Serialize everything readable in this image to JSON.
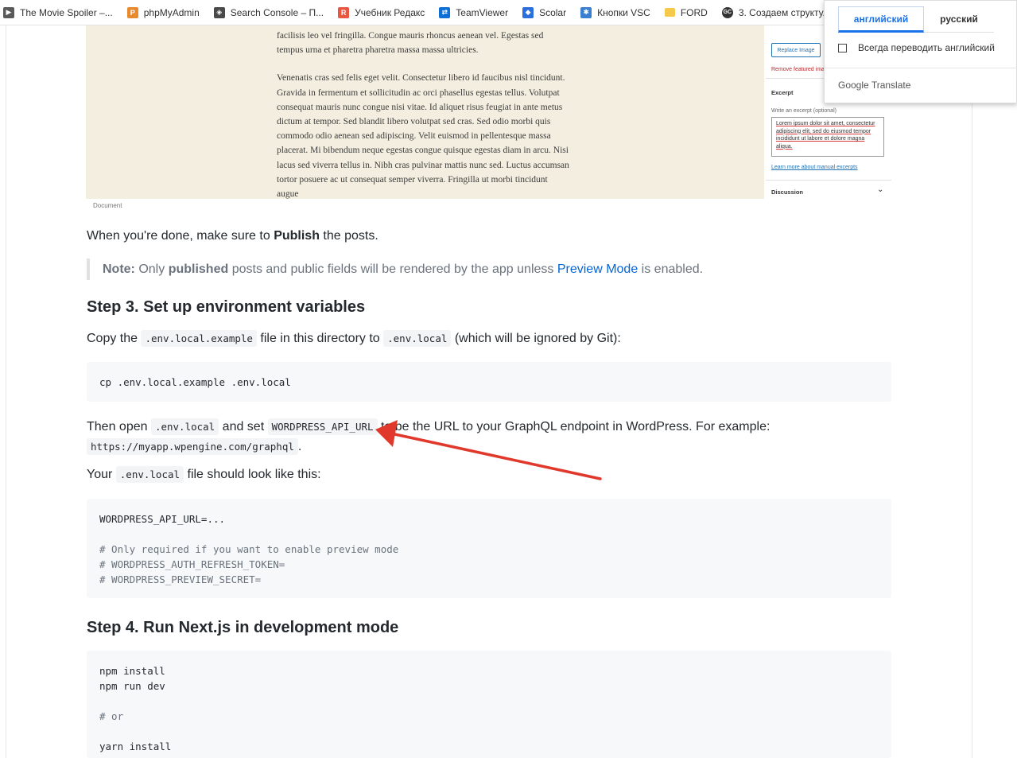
{
  "bookmarks": [
    {
      "label": "The Movie Spoiler –...",
      "icon": "movie-icon",
      "color": "#5a5a5a"
    },
    {
      "label": "phpMyAdmin",
      "icon": "phpmyadmin-icon",
      "color": "#e88a2e"
    },
    {
      "label": "Search Console – П...",
      "icon": "search-console-icon",
      "color": "#4a4a4a"
    },
    {
      "label": "Учебник Редакс",
      "icon": "redux-icon",
      "color": "#e8573f"
    },
    {
      "label": "TeamViewer",
      "icon": "teamviewer-icon",
      "color": "#0e6fd6"
    },
    {
      "label": "Scolar",
      "icon": "scolar-icon",
      "color": "#2a6fdb"
    },
    {
      "label": "Кнопки VSC",
      "icon": "vsc-icon",
      "color": "#3b7fd0"
    },
    {
      "label": "FORD",
      "icon": "folder-icon",
      "color": "#f6c94a"
    },
    {
      "label": "3. Создаем структу...",
      "icon": "gc-icon",
      "color": "#333333"
    }
  ],
  "screenshot": {
    "para1": "facilisis leo vel fringilla. Congue mauris rhoncus aenean vel. Egestas sed tempus urna et pharetra pharetra massa massa ultricies.",
    "para2": "Venenatis cras sed felis eget velit. Consectetur libero id faucibus nisl tincidunt. Gravida in fermentum et sollicitudin ac orci phasellus egestas tellus. Volutpat consequat mauris nunc congue nisi vitae. Id aliquet risus feugiat in ante metus dictum at tempor. Sed blandit libero volutpat sed cras. Sed odio morbi quis commodo odio aenean sed adipiscing. Velit euismod in pellentesque massa placerat. Mi bibendum neque egestas congue quisque egestas diam in arcu. Nisi lacus sed viverra tellus in. Nibh cras pulvinar mattis nunc sed. Luctus accumsan tortor posuere ac ut consequat semper viverra. Fringilla ut morbi tincidunt augue",
    "replace_label": "Replace Image",
    "remove_label": "Remove featured image",
    "excerpt_title": "Excerpt",
    "excerpt_hint": "Write an excerpt (optional)",
    "excerpt_text": "Lorem ipsum dolor sit amet, consectetur adipiscing elit, sed do eiusmod tempor incididunt ut labore et dolore magna aliqua.",
    "learn_label": "Learn more about manual excerpts",
    "discussion_label": "Discussion",
    "caption": "Document"
  },
  "article": {
    "done_pre": "When you're done, make sure to ",
    "done_bold": "Publish",
    "done_post": " the posts.",
    "note_label": "Note:",
    "note_pre": " Only ",
    "note_bold": "published",
    "note_mid": " posts and public fields will be rendered by the app unless ",
    "note_link": "Preview Mode",
    "note_post": " is enabled.",
    "step3_title": "Step 3. Set up environment variables",
    "copy_pre": "Copy the ",
    "copy_code1": ".env.local.example",
    "copy_mid": " file in this directory to ",
    "copy_code2": ".env.local",
    "copy_post": " (which will be ignored by Git):",
    "code1": "cp .env.local.example .env.local",
    "then_pre": "Then open ",
    "then_code1": ".env.local",
    "then_mid": " and set ",
    "then_code2": "WORDPRESS_API_URL",
    "then_post": " to be the URL to your GraphQL endpoint in WordPress. For example:",
    "then_code3": "https://myapp.wpengine.com/graphql",
    "then_end": ".",
    "your_pre": "Your ",
    "your_code": ".env.local",
    "your_post": " file should look like this:",
    "code2_line1": "WORDPRESS_API_URL=...",
    "code2_line2": "# Only required if you want to enable preview mode",
    "code2_line3": "# WORDPRESS_AUTH_REFRESH_TOKEN=",
    "code2_line4": "# WORDPRESS_PREVIEW_SECRET=",
    "step4_title": "Step 4. Run Next.js in development mode",
    "code3_line1": "npm install",
    "code3_line2": "npm run dev",
    "code3_line3": "# or",
    "code3_line4": "yarn install"
  },
  "annotation": {
    "arrow_color": "#e0392b"
  },
  "translate": {
    "tab_active": "английский",
    "tab_inactive": "русский",
    "always_label": "Всегда переводить английский",
    "brand": "Google Translate"
  }
}
